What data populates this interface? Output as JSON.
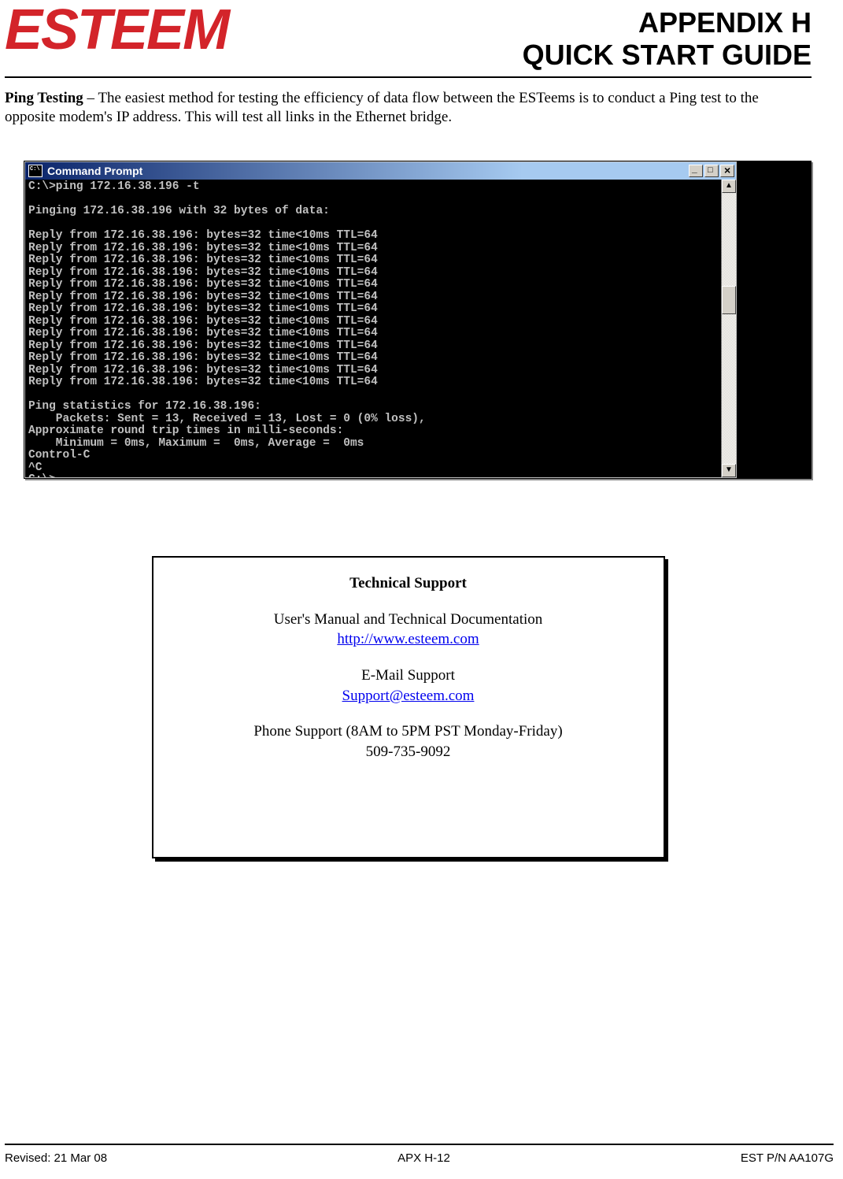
{
  "header": {
    "logo_text": "ESTEEM",
    "title_line1": "APPENDIX H",
    "title_line2": "QUICK START GUIDE"
  },
  "body": {
    "section_label": "Ping Testing",
    "section_text": " – The easiest method for testing the efficiency of data flow between the ESTeems is to conduct a Ping test to the opposite modem's IP address.  This will test all links in the Ethernet bridge."
  },
  "cmd": {
    "title": "Command Prompt",
    "content": "C:\\>ping 172.16.38.196 -t\n\nPinging 172.16.38.196 with 32 bytes of data:\n\nReply from 172.16.38.196: bytes=32 time<10ms TTL=64\nReply from 172.16.38.196: bytes=32 time<10ms TTL=64\nReply from 172.16.38.196: bytes=32 time<10ms TTL=64\nReply from 172.16.38.196: bytes=32 time<10ms TTL=64\nReply from 172.16.38.196: bytes=32 time<10ms TTL=64\nReply from 172.16.38.196: bytes=32 time<10ms TTL=64\nReply from 172.16.38.196: bytes=32 time<10ms TTL=64\nReply from 172.16.38.196: bytes=32 time<10ms TTL=64\nReply from 172.16.38.196: bytes=32 time<10ms TTL=64\nReply from 172.16.38.196: bytes=32 time<10ms TTL=64\nReply from 172.16.38.196: bytes=32 time<10ms TTL=64\nReply from 172.16.38.196: bytes=32 time<10ms TTL=64\nReply from 172.16.38.196: bytes=32 time<10ms TTL=64\n\nPing statistics for 172.16.38.196:\n    Packets: Sent = 13, Received = 13, Lost = 0 (0% loss),\nApproximate round trip times in milli-seconds:\n    Minimum = 0ms, Maximum =  0ms, Average =  0ms\nControl-C\n^C\nC:\\>_"
  },
  "support": {
    "title": "Technical Support",
    "line_manual": "User's Manual and Technical Documentation",
    "link_web": "http://www.esteem.com",
    "line_email_label": "E-Mail Support",
    "link_email": "Support@esteem.com",
    "line_phone_label": "Phone Support (8AM to 5PM PST Monday-Friday)",
    "phone_number": "509-735-9092"
  },
  "footer": {
    "left": "Revised: 21 Mar 08",
    "center": "APX H-12",
    "right": "EST P/N AA107G"
  }
}
